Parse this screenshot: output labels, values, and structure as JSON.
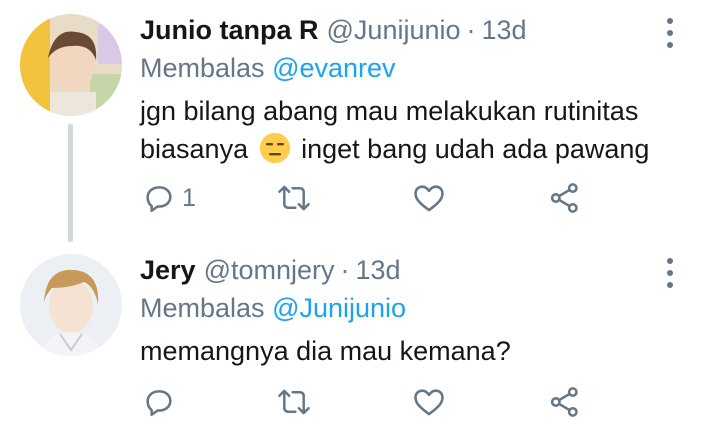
{
  "tweets": [
    {
      "name": "Junio tanpa R",
      "handle": "@Junijunio",
      "separator": "·",
      "time": "13d",
      "reply_prefix": "Membalas",
      "reply_to": "@evanrev",
      "text_before_emoji": "jgn bilang abang mau melakukan rutinitas biasanya",
      "emoji": "expressionless-face",
      "text_after_emoji": "inget bang udah ada pawang",
      "reply_count": "1",
      "retweet_count": "",
      "like_count": ""
    },
    {
      "name": "Jery",
      "handle": "@tomnjery",
      "separator": "·",
      "time": "13d",
      "reply_prefix": "Membalas",
      "reply_to": "@Junijunio",
      "text": "memangnya dia mau kemana?",
      "reply_count": "",
      "retweet_count": "",
      "like_count": ""
    }
  ],
  "icons": {
    "reply": "reply-icon",
    "retweet": "retweet-icon",
    "like": "heart-icon",
    "share": "share-icon",
    "more": "more-vertical-icon"
  },
  "colors": {
    "text": "#14171a",
    "muted": "#657786",
    "link": "#1da1f2",
    "thread_line": "#cfd9de"
  }
}
